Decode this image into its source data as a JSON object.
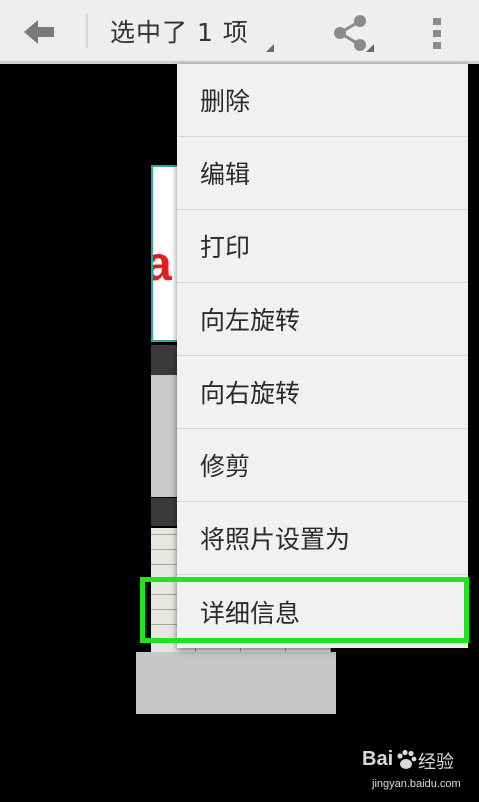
{
  "action_bar": {
    "title": "选中了 1 项",
    "back_icon": "back-arrow-icon",
    "share_icon": "share-icon",
    "overflow_icon": "more-vertical-icon"
  },
  "menu": {
    "items": [
      {
        "label": "删除"
      },
      {
        "label": "编辑"
      },
      {
        "label": "打印"
      },
      {
        "label": "向左旋转"
      },
      {
        "label": "向右旋转"
      },
      {
        "label": "修剪"
      },
      {
        "label": "将照片设置为"
      },
      {
        "label": "详细信息",
        "highlighted": true
      }
    ]
  },
  "photo": {
    "partial_text": "a"
  },
  "watermark": {
    "logo_text": "Bai",
    "site_text": "经验",
    "url": "jingyan.baidu.com"
  },
  "colors": {
    "action_bar_bg": "#eeeeee",
    "menu_bg": "#f1f1f1",
    "highlight_border": "#1ee61e",
    "background": "#000000"
  }
}
